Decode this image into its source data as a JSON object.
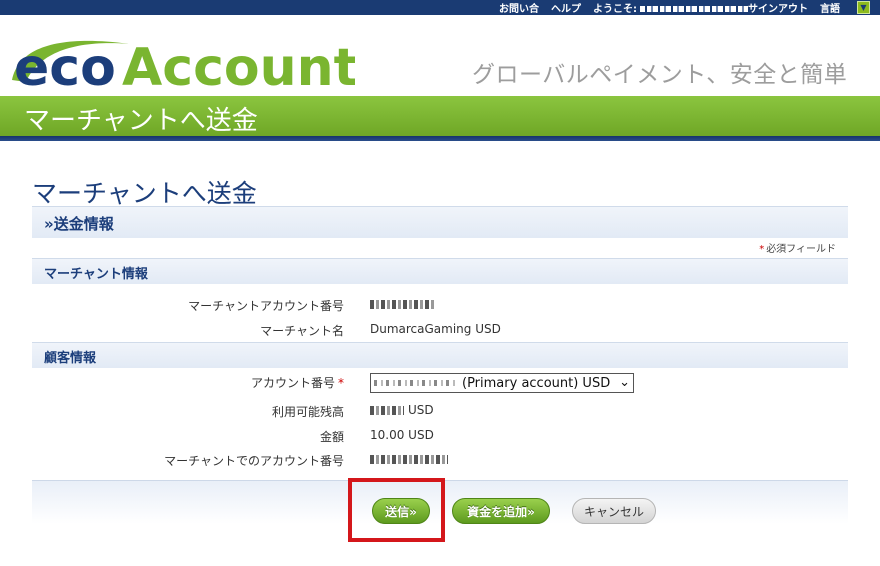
{
  "top_nav": {
    "contact": "お問い合",
    "help": "ヘルプ",
    "welcome_prefix": "ようこそ:",
    "sign_out": "サインアウト",
    "language": "言語",
    "language_dropdown_glyph": "▼"
  },
  "brand": {
    "logo_eco": "eco",
    "logo_account": "Account",
    "tagline": "グローバルペイメント、安全と簡単",
    "colors": {
      "blue": "#1c3e7b",
      "green": "#7ab530",
      "navbar": "#1a3b73",
      "highlight": "#d4171b"
    }
  },
  "band_title": "マーチャントへ送金",
  "page_title": "マーチャントへ送金",
  "section_transfer": "»送金情報",
  "required_note": "必須フィールド",
  "required_star": "*",
  "merchant_section": {
    "title": "マーチャント情報",
    "account_number_label": "マーチャントアカウント番号",
    "name_label": "マーチャント名",
    "name_value": "DumarcaGaming USD"
  },
  "customer_section": {
    "title": "顧客情報",
    "account_label": "アカウント番号",
    "account_select_text": "(Primary account) USD",
    "balance_label": "利用可能残高",
    "balance_currency": "USD",
    "amount_label": "金額",
    "amount_value": "10.00 USD",
    "merchant_account_label": "マーチャントでのアカウント番号"
  },
  "buttons": {
    "send": "送信»",
    "add_funds": "資金を追加»",
    "cancel": "キャンセル"
  }
}
